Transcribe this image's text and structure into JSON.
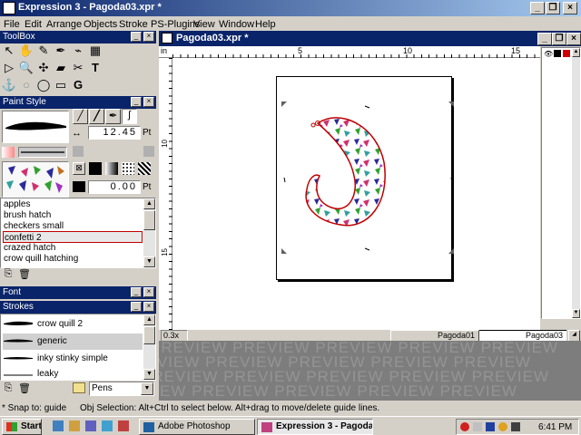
{
  "app": {
    "title": "Expression 3 - Pagoda03.xpr *"
  },
  "menu": [
    "File",
    "Edit",
    "Arrange",
    "Objects",
    "Stroke",
    "PS-Plugins",
    "View",
    "Window",
    "Help"
  ],
  "toolbox": {
    "title": "ToolBox"
  },
  "paint_style": {
    "title": "Paint Style",
    "width_value": "12.45",
    "width_unit": "Pt",
    "offset_value": "0.00",
    "offset_unit": "Pt",
    "items": [
      "apples",
      "brush hatch",
      "checkers small",
      "confetti 2",
      "crazed hatch",
      "crow quill hatching"
    ],
    "selected_index": 3
  },
  "font_palette": {
    "title": "Font"
  },
  "strokes_palette": {
    "title": "Strokes",
    "items": [
      "crow quill 2",
      "generic",
      "inky stinky simple",
      "leaky"
    ],
    "selected_index": 1,
    "category": "Pens"
  },
  "document": {
    "title": "Pagoda03.xpr *",
    "ruler_unit": "in",
    "ruler_h_labels": [
      "5",
      "10",
      "15"
    ],
    "ruler_v_labels": [
      "10",
      "15"
    ],
    "zoom": "0.3x",
    "tabs": [
      "Pagoda01",
      "Pagoda03"
    ],
    "active_tab": 1
  },
  "preview": {
    "text": "PREVIEW"
  },
  "status": {
    "snap": "* Snap to: guide",
    "hint": "Obj Selection: Alt+Ctrl to select below. Alt+drag to move/delete guide lines."
  },
  "taskbar": {
    "start": "Start",
    "tasks": [
      "Adobe Photoshop",
      "Expression 3 - Pagoda..."
    ],
    "active_task": 1,
    "clock": "6:41 PM"
  },
  "colors": {
    "title_active": "#0a246a",
    "title_gradient_end": "#a6caf0",
    "face": "#d4d0c8",
    "selection_border": "#c00000"
  }
}
